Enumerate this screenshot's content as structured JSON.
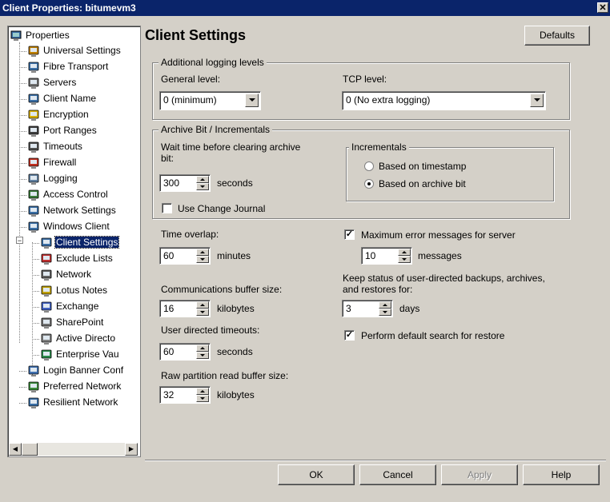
{
  "window": {
    "title": "Client Properties: bitumevm3",
    "close_glyph": "✕"
  },
  "tree": {
    "root": "Properties",
    "items": [
      {
        "label": "Universal Settings",
        "icon": "settings-icon"
      },
      {
        "label": "Fibre Transport",
        "icon": "computer-icon"
      },
      {
        "label": "Servers",
        "icon": "server-icon"
      },
      {
        "label": "Client Name",
        "icon": "computer-icon"
      },
      {
        "label": "Encryption",
        "icon": "lock-icon"
      },
      {
        "label": "Port Ranges",
        "icon": "port-icon"
      },
      {
        "label": "Timeouts",
        "icon": "clock-icon"
      },
      {
        "label": "Firewall",
        "icon": "firewall-icon"
      },
      {
        "label": "Logging",
        "icon": "log-icon"
      },
      {
        "label": "Access Control",
        "icon": "access-icon"
      },
      {
        "label": "Network Settings",
        "icon": "network-icon"
      },
      {
        "label": "Windows Client",
        "icon": "windows-client-icon"
      }
    ],
    "children": [
      {
        "label": "Client Settings",
        "icon": "computer-icon",
        "selected": true
      },
      {
        "label": "Exclude Lists",
        "icon": "exclude-icon"
      },
      {
        "label": "Network",
        "icon": "network-plug-icon"
      },
      {
        "label": "Lotus Notes",
        "icon": "lotus-icon"
      },
      {
        "label": "Exchange",
        "icon": "exchange-icon"
      },
      {
        "label": "SharePoint",
        "icon": "sharepoint-icon"
      },
      {
        "label": "Active Directo",
        "icon": "directory-icon"
      },
      {
        "label": "Enterprise Vau",
        "icon": "vault-icon"
      }
    ],
    "tail": [
      {
        "label": "Login Banner Conf",
        "icon": "banner-icon"
      },
      {
        "label": "Preferred Network",
        "icon": "preferred-network-icon"
      },
      {
        "label": "Resilient Network",
        "icon": "resilient-network-icon"
      }
    ]
  },
  "main": {
    "title": "Client Settings",
    "defaults_button": "Defaults",
    "logging": {
      "group_label": "Additional logging levels",
      "general_label": "General level:",
      "general_value": "0  (minimum)",
      "tcp_label": "TCP level:",
      "tcp_value": "0 (No extra logging)"
    },
    "archive": {
      "group_label": "Archive Bit / Incrementals",
      "wait_label_1": "Wait time before clearing archive",
      "wait_label_2": "bit:",
      "wait_value": "300",
      "wait_unit": "seconds",
      "change_journal": "Use Change Journal",
      "change_journal_checked": false,
      "incrementals_label": "Incrementals",
      "radio_timestamp": "Based on timestamp",
      "radio_archive": "Based on archive bit",
      "selected": "archive"
    },
    "time_overlap": {
      "label": "Time overlap:",
      "value": "60",
      "unit": "minutes"
    },
    "comm_buffer": {
      "label": "Communications buffer size:",
      "value": "16",
      "unit": "kilobytes"
    },
    "user_timeouts": {
      "label": "User directed timeouts:",
      "value": "60",
      "unit": "seconds"
    },
    "raw_partition": {
      "label": "Raw partition read buffer size:",
      "value": "32",
      "unit": "kilobytes"
    },
    "max_errors": {
      "label": "Maximum error messages for server",
      "checked": true,
      "value": "10",
      "unit": "messages"
    },
    "keep_status": {
      "label_1": "Keep status of user-directed backups, archives,",
      "label_2": "and restores for:",
      "value": "3",
      "unit": "days"
    },
    "default_search": {
      "label": "Perform default search for restore",
      "checked": true
    },
    "check_glyph": "✓"
  },
  "buttons": {
    "ok": "OK",
    "cancel": "Cancel",
    "apply": "Apply",
    "help": "Help"
  }
}
